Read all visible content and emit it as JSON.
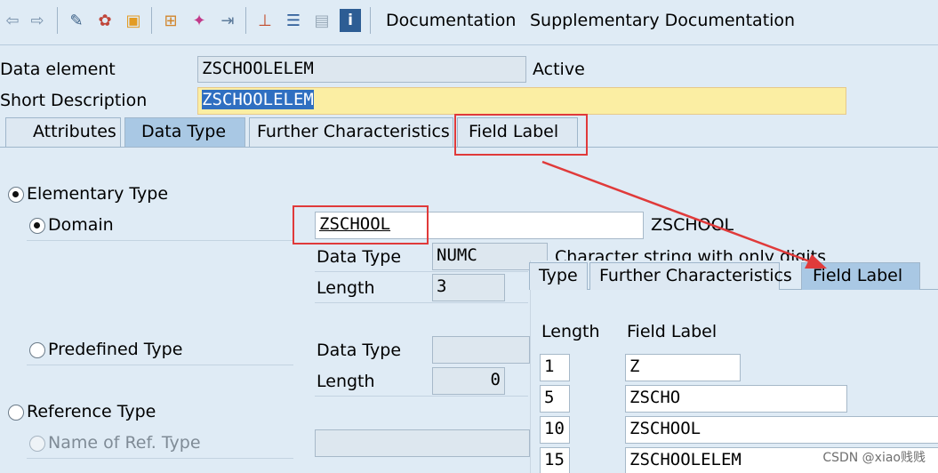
{
  "toolbar": {
    "icons": [
      "back-arrow-icon",
      "forward-arrow-icon",
      "display-change-icon",
      "activate-icon",
      "check-icon",
      "where-used-icon",
      "object-list-icon",
      "transport-icon",
      "hierarchy-icon",
      "align-icon",
      "layout-icon",
      "info-icon"
    ],
    "menu": [
      "Documentation",
      "Supplementary Documentation"
    ]
  },
  "header": {
    "data_element_label": "Data element",
    "data_element_value": "ZSCHOOLELEM",
    "status": "Active",
    "short_desc_label": "Short Description",
    "short_desc_value": "ZSCHOOLELEM"
  },
  "tabs": [
    "Attributes",
    "Data Type",
    "Further Characteristics",
    "Field Label"
  ],
  "active_tab": "Data Type",
  "data_type": {
    "elementary_label": "Elementary Type",
    "domain_label": "Domain",
    "domain_value": "ZSCHOOL",
    "domain_desc": "ZSCHOOL",
    "dt_label": "Data Type",
    "dt_value": "NUMC",
    "dt_desc": "Character string with only digits",
    "len_label": "Length",
    "len_value": "3",
    "predef_label": "Predefined Type",
    "predef_dt_label": "Data Type",
    "predef_dt_value": "",
    "predef_len_label": "Length",
    "predef_len_value": "0",
    "ref_label": "Reference Type",
    "ref_name_label": "Name of Ref. Type",
    "ref_name_value": ""
  },
  "inset": {
    "tabs": [
      "Type",
      "Further Characteristics",
      "Field Label"
    ],
    "length_header": "Length",
    "label_header": "Field Label",
    "rows": [
      {
        "length": "1",
        "label": "Z"
      },
      {
        "length": "5",
        "label": "ZSCHO"
      },
      {
        "length": "10",
        "label": "ZSCHOOL"
      },
      {
        "length": "15",
        "label": "ZSCHOOLELEM"
      }
    ]
  },
  "watermark": "CSDN @xiao贱贱",
  "colors": {
    "highlight": "#e03a3a",
    "active_tab": "#a9c8e4",
    "required_field": "#fbeea3"
  }
}
